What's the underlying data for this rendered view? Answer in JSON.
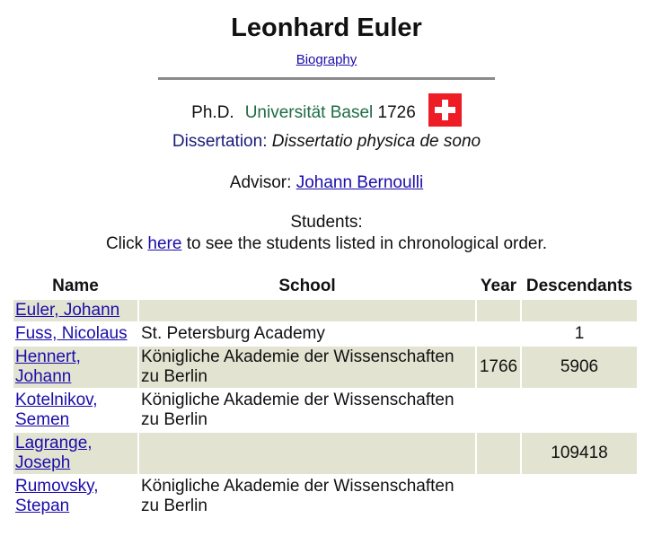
{
  "name": "Leonhard Euler",
  "biography_link": "Biography",
  "degree": {
    "type": "Ph.D.",
    "university": "Universität Basel",
    "year": "1726",
    "flag": "switzerland-flag-icon"
  },
  "dissertation": {
    "label": "Dissertation:",
    "title": "Dissertatio physica de sono"
  },
  "advisor": {
    "label": "Advisor:",
    "name": "Johann Bernoulli"
  },
  "students": {
    "heading": "Students:",
    "click_prefix": "Click",
    "click_link": "here",
    "click_suffix": "to see the students listed in chronological order."
  },
  "table": {
    "columns": [
      "Name",
      "School",
      "Year",
      "Descendants"
    ],
    "rows": [
      {
        "name": "Euler, Johann",
        "school": "",
        "year": "",
        "descendants": ""
      },
      {
        "name": "Fuss, Nicolaus",
        "school": "St. Petersburg Academy",
        "year": "",
        "descendants": "1"
      },
      {
        "name": "Hennert, Johann",
        "school": "Königliche Akademie der Wissenschaften zu Berlin",
        "year": "1766",
        "descendants": "5906"
      },
      {
        "name": "Kotelnikov, Semen",
        "school": "Königliche Akademie der Wissenschaften zu Berlin",
        "year": "",
        "descendants": ""
      },
      {
        "name": "Lagrange, Joseph",
        "school": "",
        "year": "",
        "descendants": "109418"
      },
      {
        "name": "Rumovsky, Stepan",
        "school": "Königliche Akademie der Wissenschaften zu Berlin",
        "year": "",
        "descendants": ""
      }
    ]
  },
  "colors": {
    "link": "#1a0dab",
    "university": "#1e6b46",
    "row_shade": "#e3e3d1",
    "flag_red": "#ee1c25"
  }
}
